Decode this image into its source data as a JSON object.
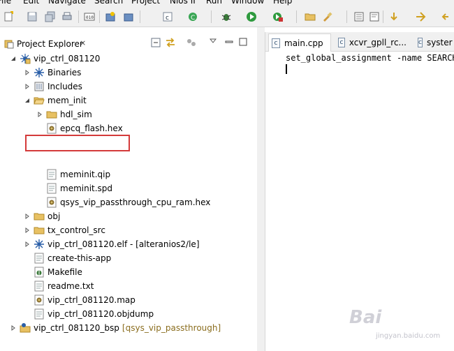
{
  "menubar": {
    "items": [
      "File",
      "Edit",
      "Navigate",
      "Search",
      "Project",
      "Nios II",
      "Run",
      "Window",
      "Help"
    ]
  },
  "toolbar": {
    "icons": [
      "new-icon",
      "save-icon",
      "save-all-icon",
      "print-icon",
      "binary-icon",
      "new-project-icon",
      "new-project-icon",
      "new-class-icon",
      "refresh-icon",
      "debug-icon",
      "run-icon",
      "external-tools-icon",
      "open-folder-icon",
      "brush-icon",
      "console-icon",
      "next-annotation-icon",
      "back-icon",
      "forward-icon"
    ]
  },
  "project_explorer": {
    "tab_label": "Project Explorer",
    "close_glyph": "⨯",
    "tree": [
      {
        "label": "vip_ctrl_081120",
        "level": 0,
        "expanded": true,
        "icon": "nios-project-icon"
      },
      {
        "label": "Binaries",
        "level": 1,
        "expanded": false,
        "icon": "binaries-icon"
      },
      {
        "label": "Includes",
        "level": 1,
        "expanded": false,
        "icon": "includes-icon"
      },
      {
        "label": "mem_init",
        "level": 1,
        "expanded": true,
        "icon": "folder-open-icon"
      },
      {
        "label": "hdl_sim",
        "level": 2,
        "expanded": false,
        "icon": "folder-icon"
      },
      {
        "label": "epcq_flash.hex",
        "level": 2,
        "icon": "hex-file-icon"
      },
      {
        "label": "meminit.qip",
        "level": 2,
        "icon": "text-file-icon"
      },
      {
        "label": "meminit.spd",
        "level": 2,
        "icon": "text-file-icon"
      },
      {
        "label": "qsys_vip_passthrough_cpu_ram.hex",
        "level": 2,
        "icon": "hex-file-icon"
      },
      {
        "label": "obj",
        "level": 1,
        "expanded": false,
        "icon": "folder-icon"
      },
      {
        "label": "tx_control_src",
        "level": 1,
        "expanded": false,
        "icon": "folder-icon"
      },
      {
        "label": "vip_ctrl_081120.elf - [alteranios2/le]",
        "level": 1,
        "expanded": false,
        "icon": "elf-icon"
      },
      {
        "label": "create-this-app",
        "level": 1,
        "icon": "text-file-icon"
      },
      {
        "label": "Makefile",
        "level": 1,
        "icon": "makefile-icon"
      },
      {
        "label": "readme.txt",
        "level": 1,
        "icon": "text-file-icon"
      },
      {
        "label": "vip_ctrl_081120.map",
        "level": 1,
        "icon": "hex-file-icon"
      },
      {
        "label": "vip_ctrl_081120.objdump",
        "level": 1,
        "icon": "text-file-icon"
      },
      {
        "label": "vip_ctrl_081120_bsp",
        "level": 0,
        "expanded": false,
        "icon": "nios-project-icon",
        "extra": "[qsys_vip_passthrough]"
      }
    ]
  },
  "editor": {
    "tabs": [
      {
        "label": "main.cpp",
        "icon": "c"
      },
      {
        "label": "xcvr_gpll_rc...",
        "icon": "c"
      },
      {
        "label": "syster",
        "icon": "c"
      }
    ],
    "code_line": "set_global_assignment -name SEARCH_"
  },
  "watermark": {
    "brand": "Bai",
    "sub": "jingyan.baidu.com"
  }
}
